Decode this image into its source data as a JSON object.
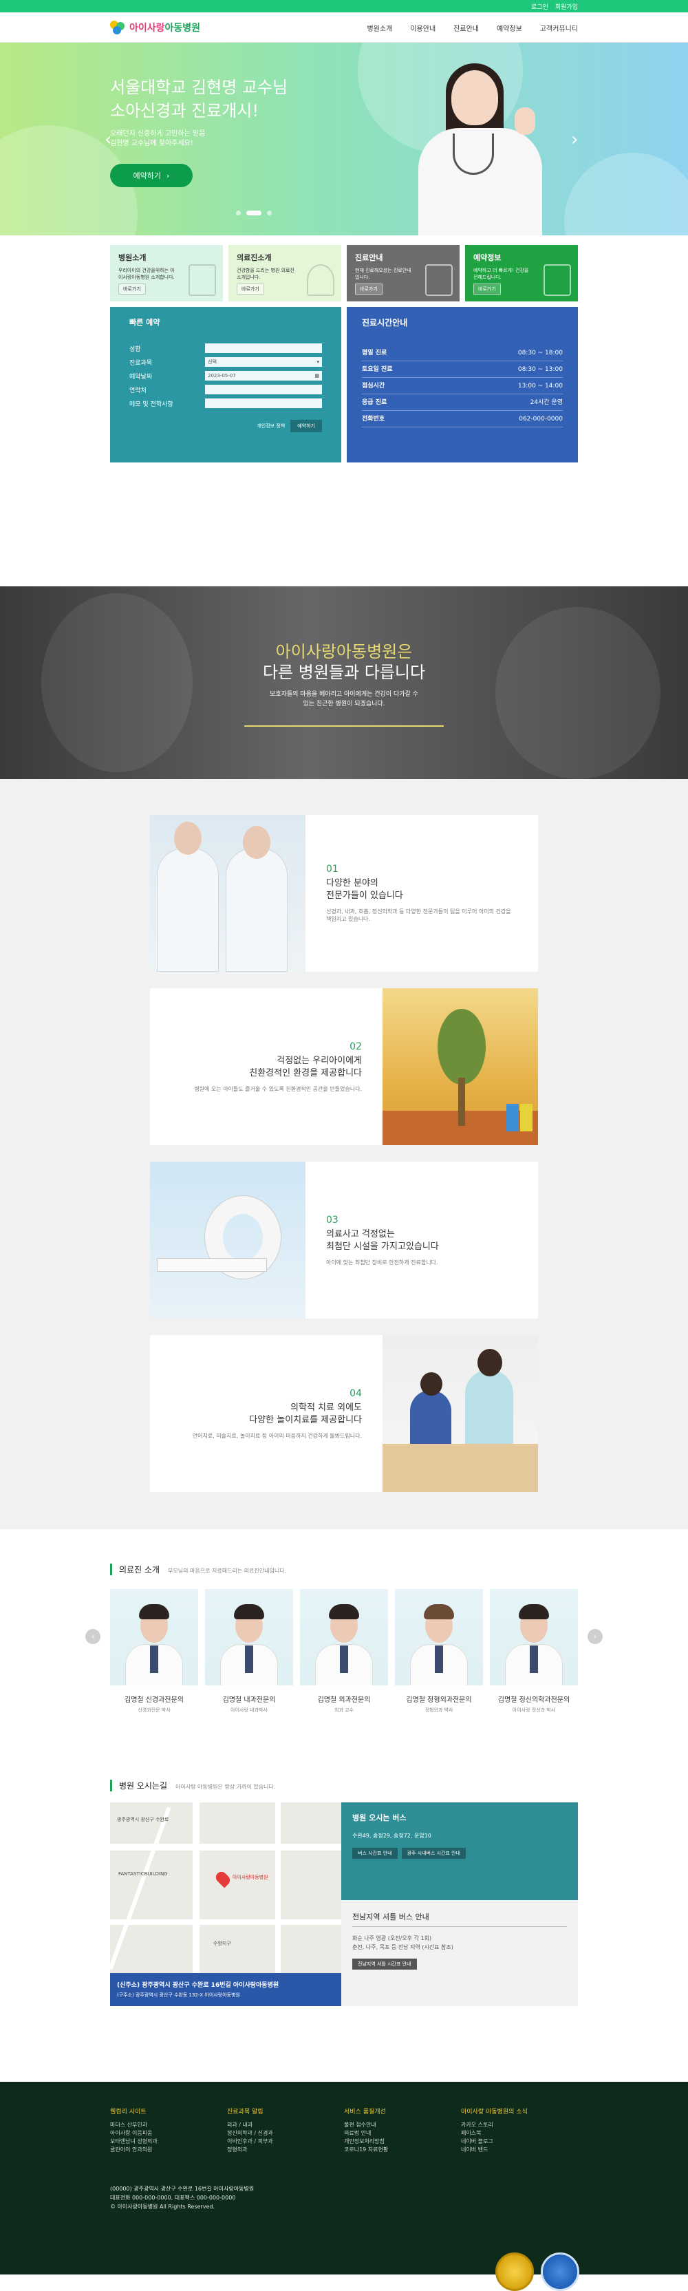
{
  "topbar": {
    "login": "로그인",
    "join": "회원가입"
  },
  "logo": {
    "brand_a": "아이사랑",
    "brand_b": "아동병원"
  },
  "nav": [
    "병원소개",
    "이용안내",
    "진료안내",
    "예약정보",
    "고객커뮤니티"
  ],
  "hero": {
    "title_1": "서울대학교 김현명 교수님",
    "title_2": "소아신경과 진료개시!",
    "desc_1": "오래던지 신중하게 고민하는 믿음",
    "desc_2": "김현명 교수님께 찾아주세요!",
    "button": "예약하기",
    "prev": "‹",
    "next": "›"
  },
  "quick_cards": [
    {
      "title": "병원소개",
      "desc": "우리아이의 건강을위하는 아이사랑아동병원 소개합니다.",
      "more": "바로가기"
    },
    {
      "title": "의료진소개",
      "desc": "건강함을 드리는 병원 의료진소개입니다.",
      "more": "바로가기"
    },
    {
      "title": "진료안내",
      "desc": "현재 진료해오셨는 진료안내입니다.",
      "more": "바로가기"
    },
    {
      "title": "예약정보",
      "desc": "예약하고 더 빠르게! 건강을 전해드립니다.",
      "more": "바로가기"
    }
  ],
  "reservation": {
    "title": "빠른 예약",
    "fields": [
      {
        "label": "성함",
        "value": ""
      },
      {
        "label": "진료과목",
        "value": "선택"
      },
      {
        "label": "예약날짜",
        "value": "2023-05-07"
      },
      {
        "label": "연락처",
        "value": ""
      },
      {
        "label": "메모 및 전학사항",
        "value": ""
      }
    ],
    "privacy": "개인정보 정책",
    "submit": "예약하기"
  },
  "hours": {
    "title": "진료시간안내",
    "rows": [
      {
        "label": "평일 진료",
        "value": "08:30 ~ 18:00"
      },
      {
        "label": "토요일 진료",
        "value": "08:30 ~ 13:00"
      },
      {
        "label": "점심시간",
        "value": "13:00 ~ 14:00"
      },
      {
        "label": "응급 진료",
        "value": "24시간 운영"
      },
      {
        "label": "전화번호",
        "value": "062-000-0000"
      }
    ]
  },
  "about": {
    "title_1": "아이사랑아동병원은",
    "title_2": "다른 병원들과 다릅니다",
    "desc_1": "보호자들의 마음을 헤아리고 아이에게는 건강이 다가갈 수",
    "desc_2": "있는 친근한 병원이 되겠습니다."
  },
  "features": [
    {
      "num": "01",
      "title_1": "다양한 분야의",
      "title_2": "전문가들이 있습니다",
      "desc": "신경과, 내과, 호흡, 정신의학과 등 다양한 전문가들이 팀을 이루어 아이의 건강을 책임지고 있습니다."
    },
    {
      "num": "02",
      "title_1": "걱정없는 우리아이에게",
      "title_2": "친환경적인 환경을 제공합니다",
      "desc": "병원에 오는 아이들도 즐거울 수 있도록 친환경적인 공간을 만들었습니다."
    },
    {
      "num": "03",
      "title_1": "의료사고 걱정없는",
      "title_2": "최첨단 시설을 가지고있습니다",
      "desc": "아이에 맞는 최첨단 장비로 안전하게 진료합니다."
    },
    {
      "num": "04",
      "title_1": "의학적 치료 외에도",
      "title_2": "다양한 놀이치료를 제공합니다",
      "desc": "언어치료, 미술치료, 놀이치료 등 아이의 마음까지 건강하게 돌봐드립니다."
    }
  ],
  "doctors": {
    "title": "의료진 소개",
    "subtitle": "부모님의 마음으로 치료해드리는 의료진안내입니다.",
    "list": [
      {
        "name": "김명철 신경과전문의",
        "desc": "신경과전문 박사"
      },
      {
        "name": "김명철 내과전문의",
        "desc": "아이사랑 내과박사"
      },
      {
        "name": "김명철 외과전문의",
        "desc": "외과 교수"
      },
      {
        "name": "김명철 정형외과전문의",
        "desc": "정형외과 박사"
      },
      {
        "name": "김명철 정신의학과전문의",
        "desc": "아이사랑 정신과 박사"
      }
    ],
    "prev": "‹",
    "next": "›"
  },
  "location": {
    "title": "병원 오시는길",
    "subtitle": "아이사랑 아동병원은 항상 가까이 있습니다.",
    "map_labels": [
      "광주광역시 광산구 수완로",
      "FANTASTICBUILDING",
      "아이사랑아동병원",
      "수완지구"
    ],
    "address_title": "(신주소) 광주광역시 광산구 수완로 16번길 아이사랑아동병원",
    "address_old": "(구주소) 광주광역시 광산구 수완동 132-X 아이사랑아동병원",
    "bus_title": "병원 오시는 버스",
    "bus_lines": [
      "수완49, 송정29, 송정72, 운암10"
    ],
    "bus_btn_1": "버스 시간표 안내",
    "bus_btn_2": "광주 시내버스 시간표 안내",
    "local_title": "전남지역 셔틀 버스 안내",
    "local_lines": [
      "화순 나주 영광 (오전/오후 각 1회)",
      "춘천, 나주, 목포 등 전남 지역 (시간표 참조)"
    ],
    "local_btn": "전남지역 셔틀 시간표 안내"
  },
  "footer": {
    "cols": [
      {
        "title": "웰컴리 사이트",
        "links": [
          "마더스 산부인과",
          "아이사랑 이음피움",
          "보타엔남녀 성형외과",
          "클린아이 안과의원"
        ]
      },
      {
        "title": "진료과목 알림",
        "links": [
          "외과 / 내과",
          "정신의학과 / 신경과",
          "이비인후과 / 피부과",
          "정형외과"
        ]
      },
      {
        "title": "서비스 품질개선",
        "links": [
          "불편 접수안내",
          "의료법 안내",
          "개인정보처리방침",
          "코로나19 치료현황"
        ]
      },
      {
        "title": "아이사랑 아동병원의 소식",
        "links": [
          "카카오 스토리",
          "페이스북",
          "네이버 블로그",
          "네이버 밴드"
        ]
      }
    ],
    "info_1": "(00000) 광주광역시 광산구 수완로 16번길 아이사랑아동병원",
    "info_2": "대표전화 000-000-0000, 대표팩스 000-000-0000",
    "copy": "© 아이사랑아동병원 All Rights Reserved."
  }
}
